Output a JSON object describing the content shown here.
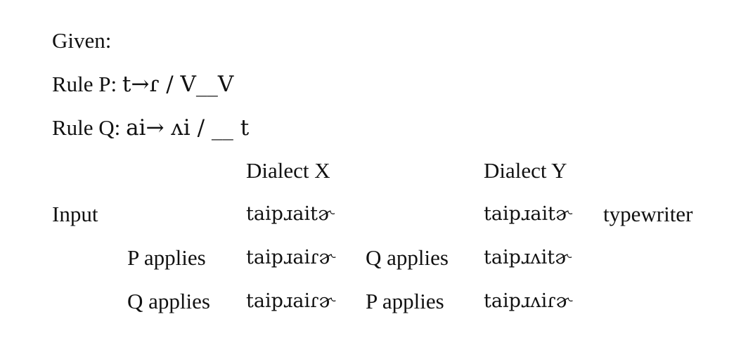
{
  "heading": "Given:",
  "rules": [
    {
      "label": "Rule P:",
      "formula": "t→ɾ / V__V"
    },
    {
      "label": "Rule Q:",
      "formula": "ai→ ʌi / __ t"
    }
  ],
  "table": {
    "headers": {
      "dialect_x": "Dialect X",
      "dialect_y": "Dialect Y"
    },
    "input_row": {
      "label": "Input",
      "x_form": "taipɹaitɚ",
      "y_form": "taipɹaitɚ",
      "gloss": "typewriter"
    },
    "derivation_rows": [
      {
        "x_step": "P applies",
        "x_form": "taipɹaiɾɚ",
        "y_step": "Q applies",
        "y_form": "taipɹʌitɚ"
      },
      {
        "x_step": "Q applies",
        "x_form": "taipɹaiɾɚ",
        "y_step": "P applies",
        "y_form": "taipɹʌiɾɚ"
      }
    ]
  }
}
